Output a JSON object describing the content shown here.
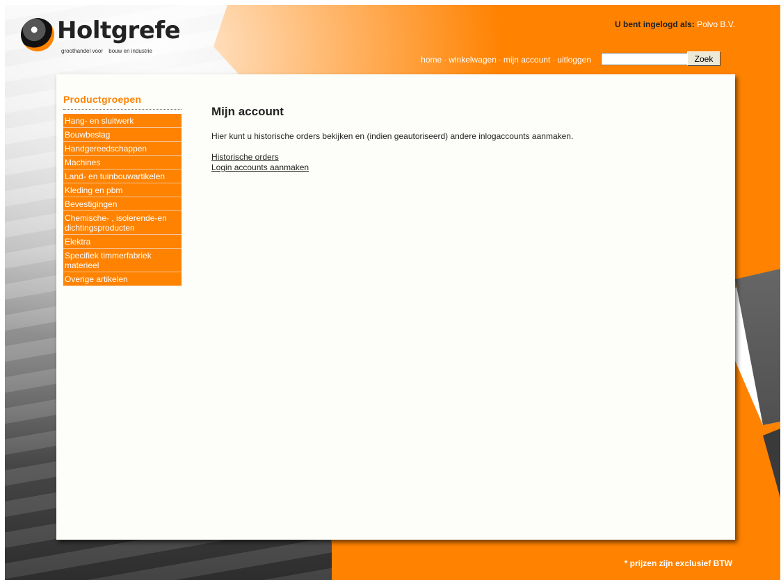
{
  "header": {
    "logo_text": "Holtgrefe",
    "logo_subtitle_left": "groothandel voor",
    "logo_subtitle_right": "bouw en industrie",
    "login_label": "U bent ingelogd als:",
    "login_user": "Polvo B.V."
  },
  "nav": {
    "items": [
      "home",
      "winkelwagen",
      "mijn account",
      "uitloggen"
    ],
    "separator": "·"
  },
  "search": {
    "value": "",
    "button_label": "Zoek"
  },
  "sidebar": {
    "title": "Productgroepen",
    "items": [
      "Hang- en sluitwerk",
      "Bouwbeslag",
      "Handgereedschappen",
      "Machines",
      "Land- en tuinbouwartikelen",
      "Kleding en pbm",
      "Bevestigingen",
      "Chemische- , isolerende-en dichtingsproducten",
      "Elektra",
      "Specifiek timmerfabriek materieel",
      "Overige artikelen"
    ]
  },
  "main": {
    "title": "Mijn account",
    "intro": "Hier kunt u historische orders bekijken en (indien geautoriseerd) andere inlogaccounts aanmaken.",
    "links": [
      "Historische orders",
      "Login accounts aanmaken"
    ]
  },
  "footer": {
    "note": "* prijzen zijn exclusief BTW"
  },
  "colors": {
    "brand_orange": "#ff8200",
    "panel_bg": "#fdfdf9"
  }
}
